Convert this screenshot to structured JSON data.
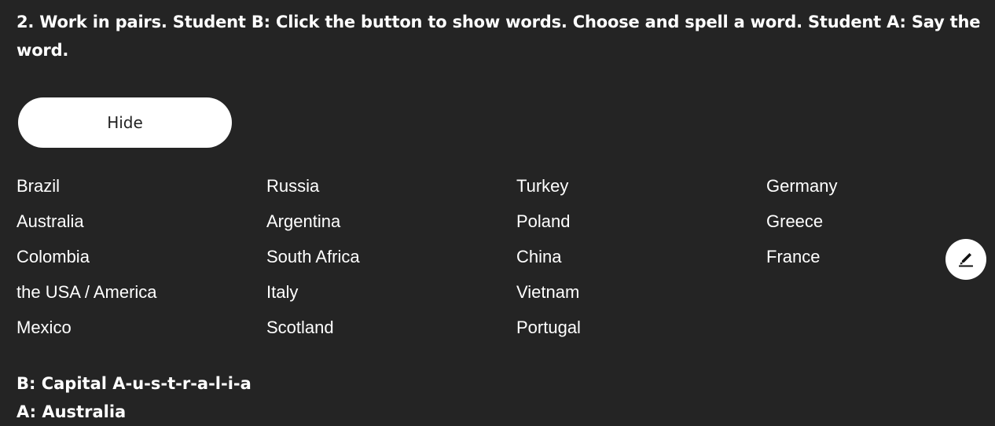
{
  "instruction": "2. Work in pairs. Student B: Click the button to show words. Choose and spell a word. Student A: Say the word.",
  "toggle_button_label": "Hide",
  "word_columns": [
    [
      "Brazil",
      "Australia",
      "Colombia",
      "the USA / America",
      "Mexico"
    ],
    [
      "Russia",
      "Argentina",
      "South Africa",
      "Italy",
      "Scotland"
    ],
    [
      "Turkey",
      "Poland",
      "China",
      "Vietnam",
      "Portugal"
    ],
    [
      "Germany",
      "Greece",
      "France"
    ]
  ],
  "example": {
    "line_b": "B: Capital A-u-s-t-r-a-l-i-a",
    "line_a": "A: Australia"
  },
  "pen_icon": "pen-icon",
  "colors": {
    "background": "#242424",
    "text": "#ffffff",
    "button_bg": "#ffffff",
    "button_text": "#222222"
  }
}
